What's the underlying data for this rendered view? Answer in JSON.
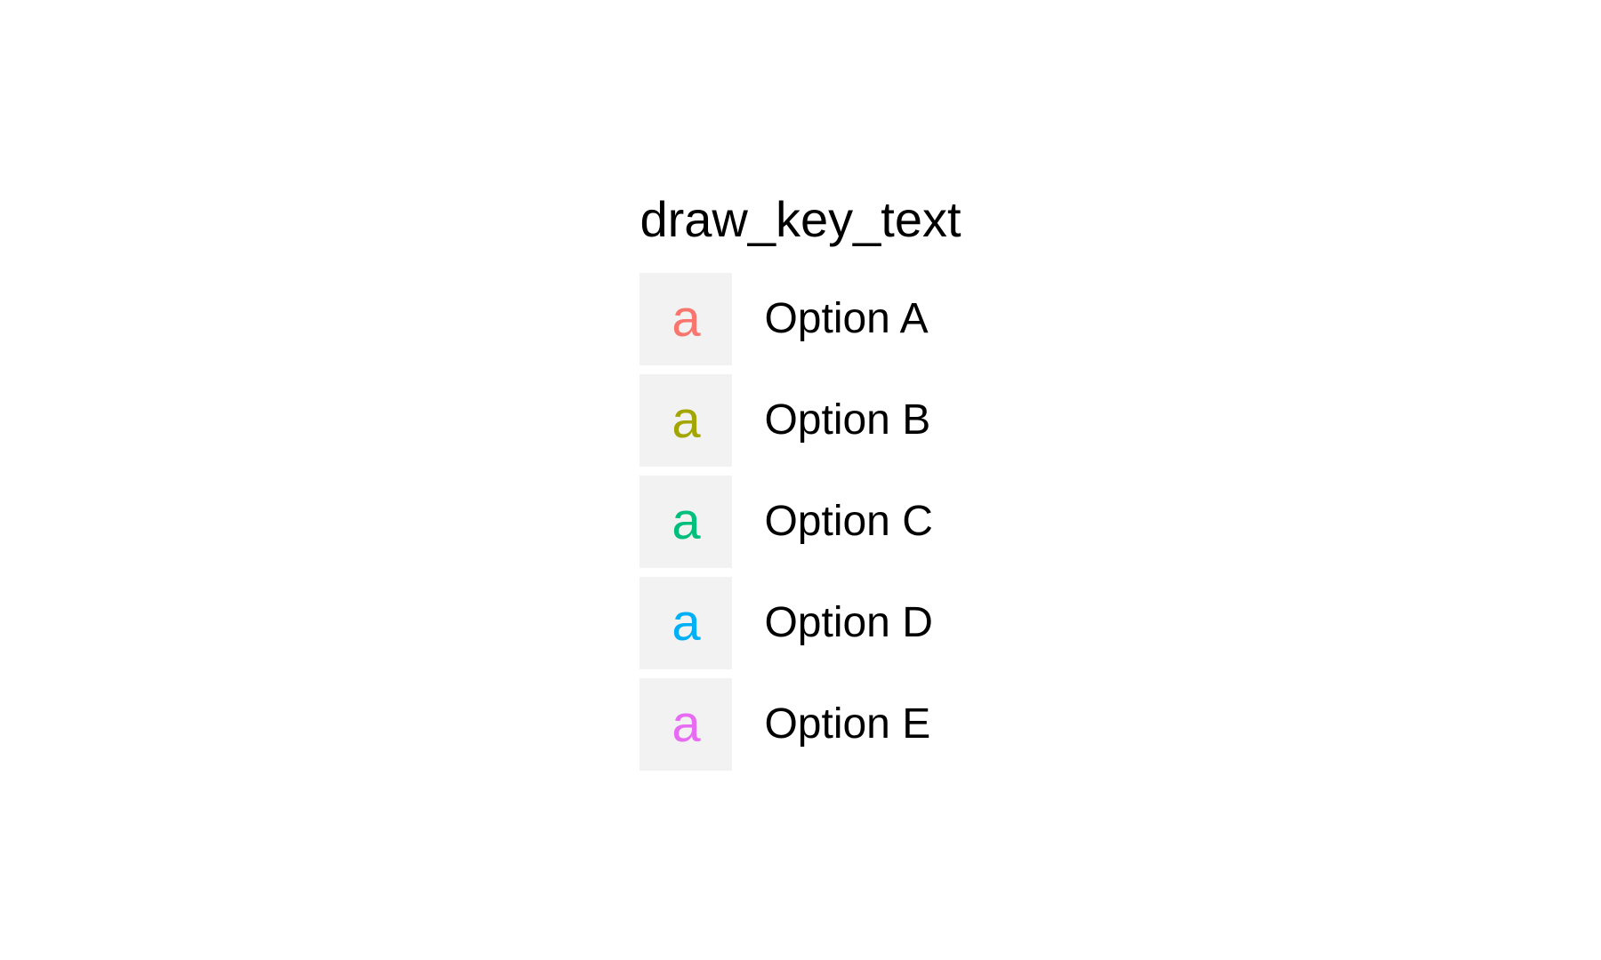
{
  "chart_data": {
    "type": "table",
    "title": "draw_key_text",
    "key_glyph": "a",
    "series": [
      {
        "name": "Option A",
        "color": "#F8766D"
      },
      {
        "name": "Option B",
        "color": "#A3A500"
      },
      {
        "name": "Option C",
        "color": "#00BF7D"
      },
      {
        "name": "Option D",
        "color": "#00B0F6"
      },
      {
        "name": "Option E",
        "color": "#E76BF3"
      }
    ]
  },
  "legend": {
    "title": "draw_key_text",
    "key_glyph": "a",
    "items": [
      {
        "label": "Option A",
        "color": "#F8766D"
      },
      {
        "label": "Option B",
        "color": "#A3A500"
      },
      {
        "label": "Option C",
        "color": "#00BF7D"
      },
      {
        "label": "Option D",
        "color": "#00B0F6"
      },
      {
        "label": "Option E",
        "color": "#E76BF3"
      }
    ]
  }
}
